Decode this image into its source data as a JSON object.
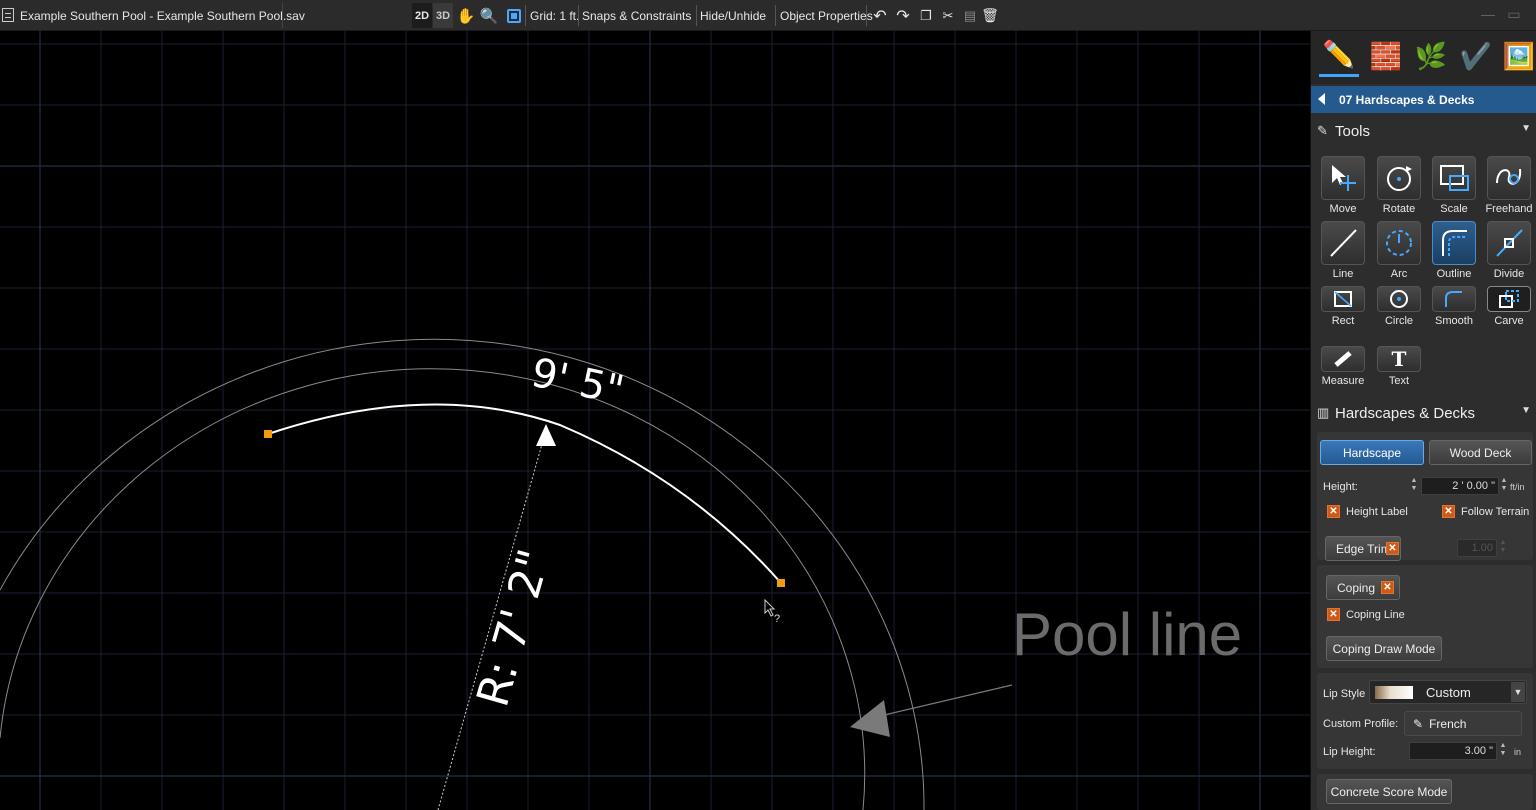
{
  "titlebar": {
    "title": "Example Southern Pool - Example Southern Pool.sav"
  },
  "toolbar": {
    "btn_2d": "2D",
    "btn_3d": "3D",
    "grid_label": "Grid: 1 ft.",
    "snaps_label": "Snaps & Constraints",
    "hide_label": "Hide/Unhide",
    "props_label": "Object Properties",
    "icons": [
      "pan-hand-icon",
      "zoom-icon",
      "zoom-fit-icon",
      "undo-icon",
      "redo-icon",
      "copy-icon",
      "cut-icon",
      "paste-icon",
      "delete-icon"
    ]
  },
  "canvas": {
    "arc_length_label": "9' 5\"",
    "radius_label": "R: 7' 2\"",
    "annotation": "Pool line",
    "cursor_label": "?",
    "colors": {
      "arc": "#ffffff",
      "handle": "#f39c12",
      "grid": "#1c2333",
      "guide": "#7a7a7a",
      "annotation": "#6b6b6b"
    }
  },
  "panel": {
    "section_title": "07 Hardscapes & Decks",
    "tools_title": "Tools",
    "tools": [
      {
        "label": "Move",
        "icon": "move-icon"
      },
      {
        "label": "Rotate",
        "icon": "rotate-icon"
      },
      {
        "label": "Scale",
        "icon": "scale-icon"
      },
      {
        "label": "Freehand",
        "icon": "freehand-icon"
      },
      {
        "label": "Line",
        "icon": "line-icon"
      },
      {
        "label": "Arc",
        "icon": "arc-icon"
      },
      {
        "label": "Outline",
        "icon": "outline-icon"
      },
      {
        "label": "Divide",
        "icon": "divide-icon"
      },
      {
        "label": "Rect",
        "icon": "rect-icon"
      },
      {
        "label": "Circle",
        "icon": "circle-icon"
      },
      {
        "label": "Smooth",
        "icon": "smooth-icon"
      },
      {
        "label": "Carve",
        "icon": "carve-icon"
      },
      {
        "label": "Measure",
        "icon": "measure-icon"
      },
      {
        "label": "Text",
        "icon": "text-icon"
      }
    ],
    "hardscapes_title": "Hardscapes & Decks",
    "tab_hardscape": "Hardscape",
    "tab_wood_deck": "Wood Deck",
    "height_label": "Height:",
    "height_value": "2 ' 0.00 \"",
    "height_unit": "ft/in",
    "height_label_check": "Height Label",
    "follow_terrain_check": "Follow Terrain",
    "edge_trim_label": "Edge Trim",
    "edge_trim_value": "1.00",
    "coping_label": "Coping",
    "coping_line_check": "Coping Line",
    "coping_draw_mode": "Coping Draw Mode",
    "lip_style_label": "Lip Style",
    "lip_style_value": "Custom",
    "custom_profile_label": "Custom Profile:",
    "custom_profile_value": "French",
    "lip_height_label": "Lip Height:",
    "lip_height_value": "3.00 \"",
    "lip_height_unit": "in",
    "concrete_score_mode": "Concrete Score Mode"
  }
}
